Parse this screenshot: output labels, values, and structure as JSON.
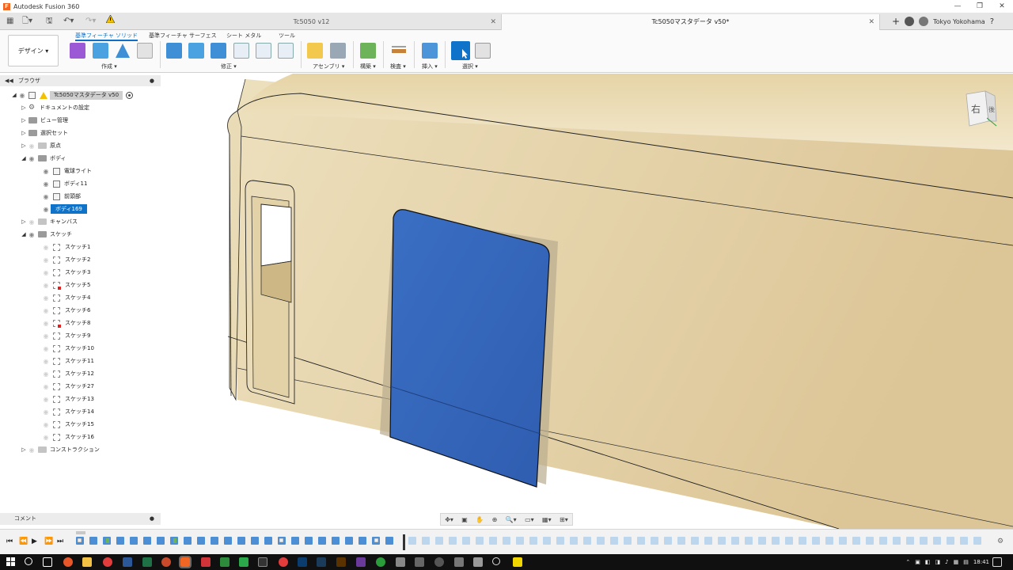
{
  "window": {
    "title": "Autodesk Fusion 360",
    "logo_letter": "F",
    "controls": [
      "—",
      "❐",
      "✕"
    ]
  },
  "tabs": [
    {
      "label": "Tc5050 v12",
      "active": false
    },
    {
      "label": "Tc5050マスタデータ v50*",
      "active": true
    }
  ],
  "user": {
    "name": "Tokyo Yokohama"
  },
  "ribbon": {
    "workspace_button": "デザイン ▾",
    "tabs": [
      "基準フィーチャ ソリッド",
      "基準フィーチャ サーフェス",
      "シート メタル",
      "ツール"
    ],
    "groups": [
      "作成 ▾",
      "修正 ▾",
      "アセンブリ ▾",
      "構築 ▾",
      "検査 ▾",
      "挿入 ▾",
      "選択 ▾"
    ]
  },
  "browser": {
    "title": "ブラウザ",
    "root": {
      "label": "Tc5050マスタデータ v50"
    },
    "nodes": [
      {
        "label": "ドキュメントの設定"
      },
      {
        "label": "ビュー管理"
      },
      {
        "label": "選択セット"
      },
      {
        "label": "原点"
      },
      {
        "label": "ボディ"
      },
      {
        "label": "電球ライト"
      },
      {
        "label": "ボディ11"
      },
      {
        "label": "前頭部"
      },
      {
        "label": "ボディ169"
      },
      {
        "label": "キャンバス"
      },
      {
        "label": "スケッチ"
      },
      {
        "label": "スケッチ1"
      },
      {
        "label": "スケッチ2"
      },
      {
        "label": "スケッチ3"
      },
      {
        "label": "スケッチ5"
      },
      {
        "label": "スケッチ4"
      },
      {
        "label": "スケッチ6"
      },
      {
        "label": "スケッチ8"
      },
      {
        "label": "スケッチ9"
      },
      {
        "label": "スケッチ10"
      },
      {
        "label": "スケッチ11"
      },
      {
        "label": "スケッチ12"
      },
      {
        "label": "スケッチ27"
      },
      {
        "label": "スケッチ13"
      },
      {
        "label": "スケッチ14"
      },
      {
        "label": "スケッチ15"
      },
      {
        "label": "スケッチ16"
      },
      {
        "label": "コンストラクション"
      }
    ]
  },
  "comments": {
    "label": "コメント"
  },
  "viewcube": {
    "front_label": "右",
    "side_label": "後"
  },
  "taskbar": {
    "time": "18:41"
  },
  "colors": {
    "accent": "#0f73c9",
    "model_body": "#e8d6aa",
    "selected_face": "#3a6fc4"
  }
}
